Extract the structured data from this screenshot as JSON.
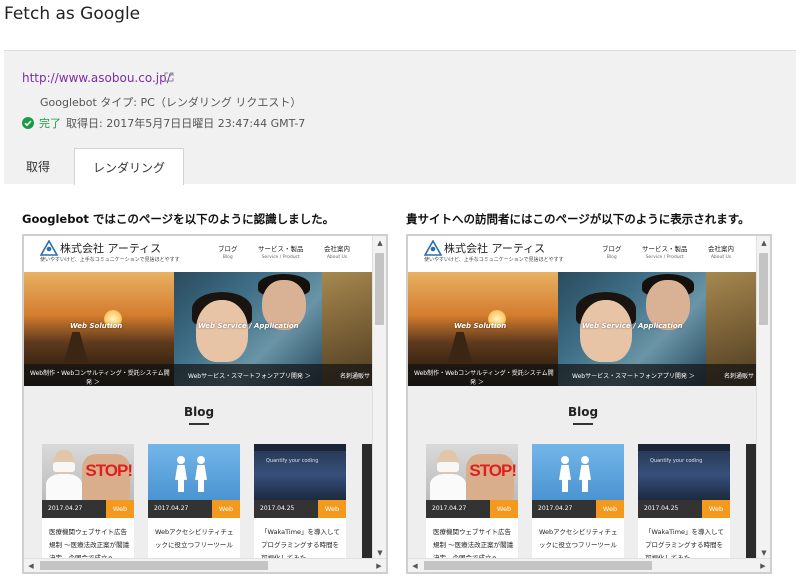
{
  "page": {
    "title": "Fetch as Google"
  },
  "fetch": {
    "url": "http://www.asobou.co.jp/",
    "type_text": "Googlebot タイプ: PC（レンダリング リクエスト）",
    "status_label": "完了",
    "fetched_text": "取得日: 2017年5月7日日曜日 23:47:44 GMT-7"
  },
  "tabs": [
    {
      "label": "取得"
    },
    {
      "label": "レンダリング"
    }
  ],
  "captions": {
    "googlebot": "Googlebot ではこのページを以下のように認識しました。",
    "visitor": "貴サイトへの訪問者にはこのページが以下のように表示されます。"
  },
  "site": {
    "logo_text": "株式会社 アーティス",
    "tagline": "使いやすいけど、上手なコミュニケーションで見捨ほとやすす",
    "nav": [
      {
        "main": "ブログ",
        "sub": "Blog"
      },
      {
        "main": "サービス・製品",
        "sub": "Service / Product"
      },
      {
        "main": "会社案内",
        "sub": "About Us"
      }
    ],
    "hero": [
      {
        "label": "Web Solution",
        "caption_line1": "Web制作・Webコンサルティング・受託システム開",
        "caption_line2": "発 ＞"
      },
      {
        "label": "Web Service / Application",
        "caption_line1": "Webサービス・スマートフォンアプリ開発 ＞",
        "caption_line2": ""
      },
      {
        "label": "",
        "caption_line1": "名刺通販サ",
        "caption_line2": ""
      }
    ],
    "blog_heading": "Blog",
    "cards": [
      {
        "date": "2017.04.27",
        "category": "Web",
        "title": "医療機関ウェブサイト広告規制 ～医療法改正案が閣議決定、今国会で成立へ",
        "image_text": "STOP!"
      },
      {
        "date": "2017.04.27",
        "category": "Web",
        "title": "Webアクセシビリティチェックに役立つフリーツール",
        "image_text": ""
      },
      {
        "date": "2017.04.25",
        "category": "Web",
        "title": "「WakaTime」を導入してプログラミングする時間を可視化してみた",
        "image_text": "Quantify your coding"
      }
    ]
  },
  "colors": {
    "link": "#7a2ea8",
    "status_ok": "#1a9c47",
    "accent_orange": "#f39a1e"
  },
  "icons": {
    "external_link": "external-link-icon",
    "status": "check-circle-icon"
  }
}
